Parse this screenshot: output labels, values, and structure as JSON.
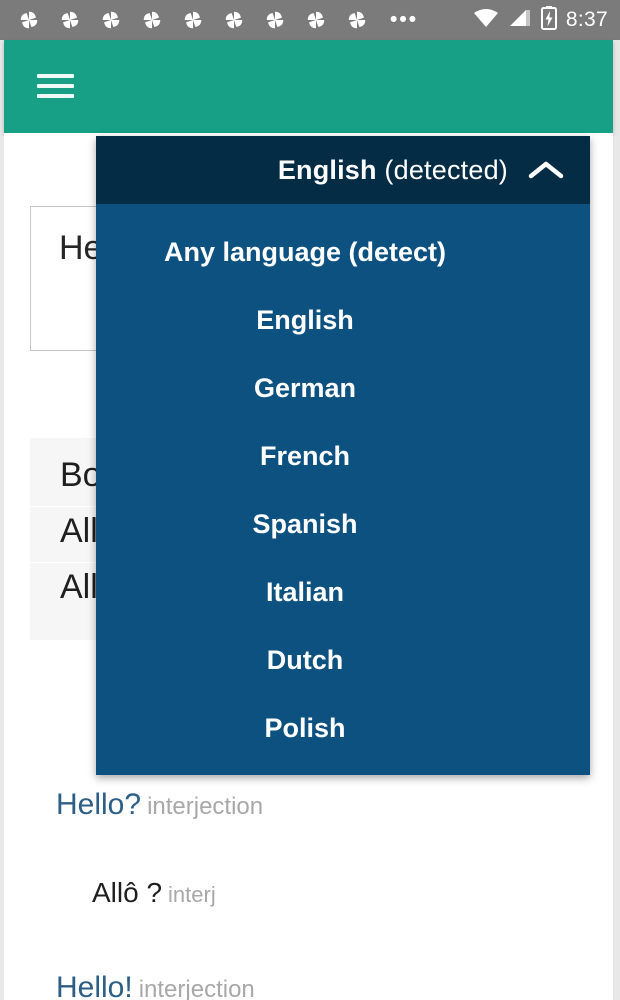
{
  "status_bar": {
    "notification_icon": "pinwheel-icon",
    "notification_count": 9,
    "overflow_icon": "ellipsis-icon",
    "overflow_label": "•••",
    "wifi_icon": "wifi-icon",
    "signal_icon": "cell-signal-icon",
    "battery_icon": "battery-charging-icon",
    "time": "8:37",
    "background": "#7b7b7b"
  },
  "app_bar": {
    "menu_icon": "hamburger-menu-icon",
    "background": "#17a085"
  },
  "source_panel": {
    "input_value": "Hello",
    "results": [
      "Bonjour",
      "Allô",
      "Allô"
    ]
  },
  "dictionary": {
    "entries": [
      {
        "word": "Hello?",
        "pos": "interjection",
        "translations": [
          {
            "word": "Allô ?",
            "pos": "interj"
          }
        ]
      },
      {
        "word": "Hello!",
        "pos": "interjection",
        "translations": []
      }
    ]
  },
  "language_dropdown": {
    "selected_bold": "English",
    "selected_light": "(detected)",
    "collapse_icon": "chevron-up-icon",
    "header_background": "#042c44",
    "body_background": "#0d5180",
    "options": [
      "Any language (detect)",
      "English",
      "German",
      "French",
      "Spanish",
      "Italian",
      "Dutch",
      "Polish"
    ]
  },
  "colors": {
    "teal_accent": "#17a085",
    "dropdown_dark": "#042c44",
    "dropdown_blue": "#0d5180",
    "dict_word_blue": "#2d5e86",
    "dict_pos_gray": "#a8a8a8"
  }
}
